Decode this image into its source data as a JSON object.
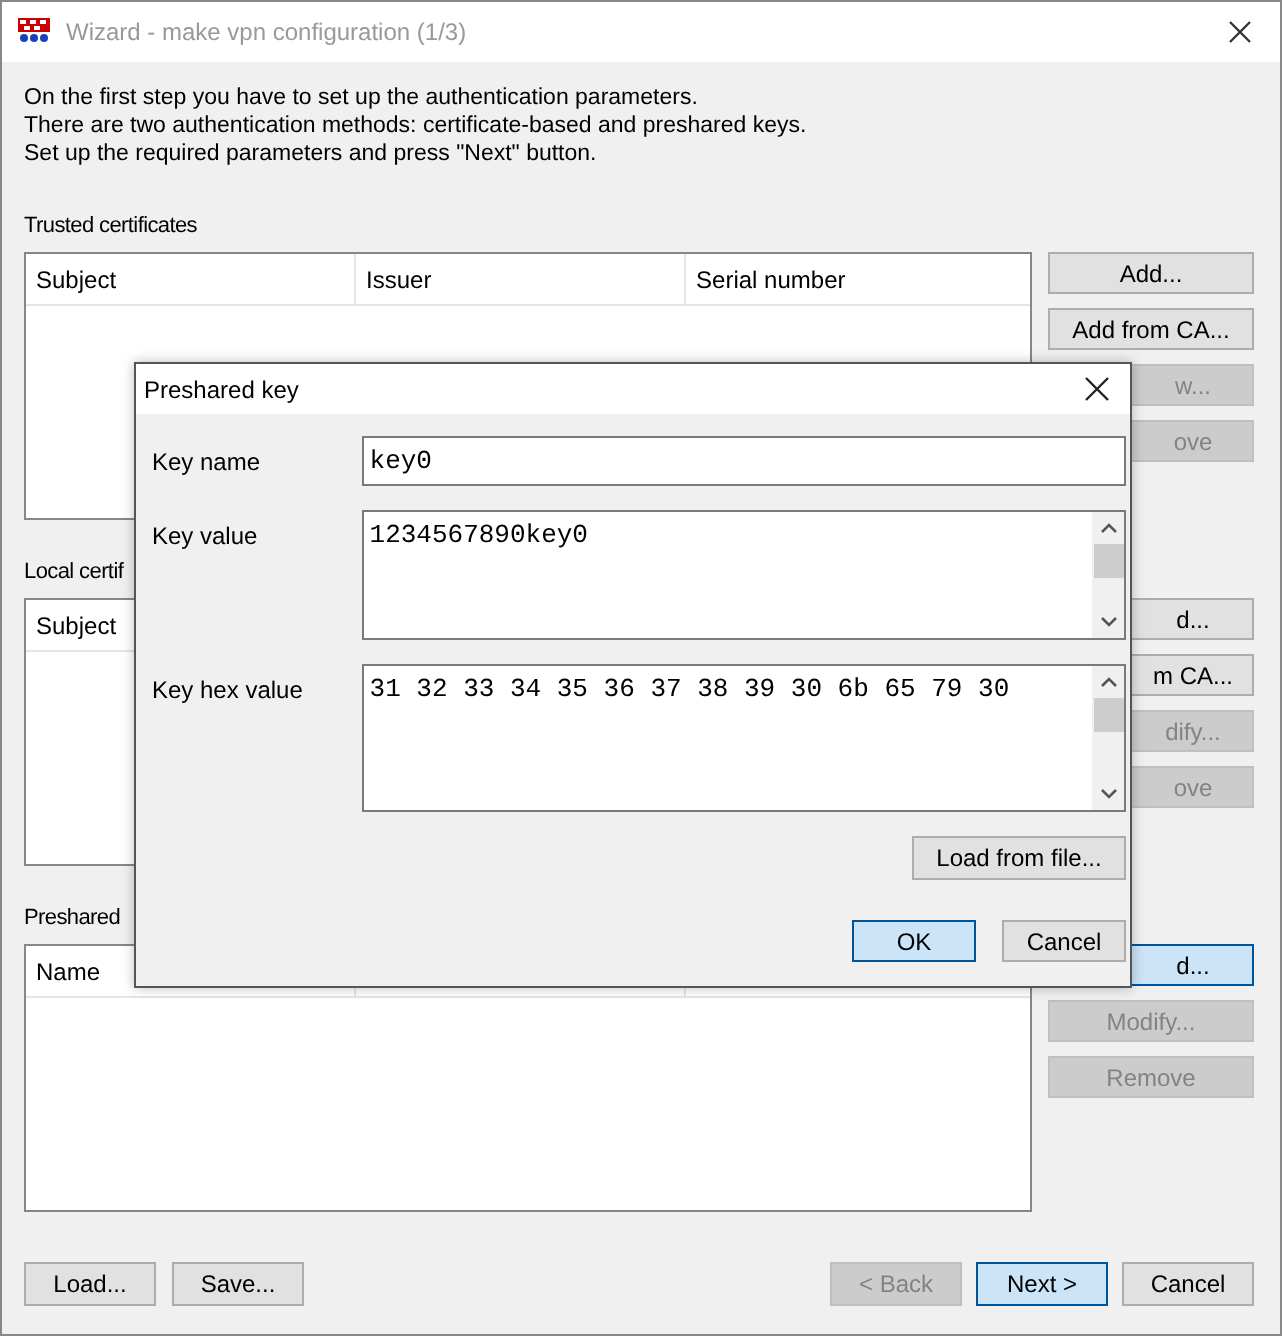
{
  "window": {
    "title": "Wizard - make vpn configuration (1/3)"
  },
  "intro": [
    "On the first step you have to set up the authentication parameters.",
    "There are two authentication methods: certificate-based and preshared keys.",
    "Set up the required parameters and press \"Next\" button."
  ],
  "sections": [
    {
      "label": "Trusted certificates",
      "columns": [
        "Subject",
        "Issuer",
        "Serial number"
      ],
      "buttons": [
        {
          "label": "Add...",
          "disabled": false,
          "covered": false,
          "highlighted": false
        },
        {
          "label": "Add from CA...",
          "disabled": false,
          "covered": false,
          "highlighted": false
        },
        {
          "label": "w...",
          "disabled": true,
          "covered": true,
          "highlighted": false
        },
        {
          "label": "ove",
          "disabled": true,
          "covered": true,
          "highlighted": false
        }
      ]
    },
    {
      "label": "Local certif",
      "columns": [
        "Subject"
      ],
      "buttons": [
        {
          "label": "d...",
          "disabled": false,
          "covered": true,
          "highlighted": false
        },
        {
          "label": "m CA...",
          "disabled": false,
          "covered": true,
          "highlighted": false
        },
        {
          "label": "dify...",
          "disabled": true,
          "covered": true,
          "highlighted": false
        },
        {
          "label": "ove",
          "disabled": true,
          "covered": true,
          "highlighted": false
        }
      ]
    },
    {
      "label": "Preshared",
      "columns": [
        "Name"
      ],
      "buttons": [
        {
          "label": "d...",
          "disabled": false,
          "covered": true,
          "highlighted": true
        },
        {
          "label": "Modify...",
          "disabled": true,
          "covered": false,
          "highlighted": false
        },
        {
          "label": "Remove",
          "disabled": true,
          "covered": false,
          "highlighted": false
        }
      ]
    }
  ],
  "footer": {
    "left": [
      {
        "label": "Load...",
        "disabled": false,
        "highlighted": false
      },
      {
        "label": "Save...",
        "disabled": false,
        "highlighted": false
      }
    ],
    "right": [
      {
        "label": "< Back",
        "disabled": true,
        "highlighted": false
      },
      {
        "label": "Next >",
        "disabled": false,
        "highlighted": true
      },
      {
        "label": "Cancel",
        "disabled": false,
        "highlighted": false
      }
    ]
  },
  "dialog": {
    "title": "Preshared key",
    "fields": [
      {
        "kind": "line",
        "label": "Key name",
        "value": "key0"
      },
      {
        "kind": "area",
        "label": "Key value",
        "value": "1234567890key0"
      },
      {
        "kind": "area",
        "label": "Key hex value",
        "value": "31 32 33 34 35 36 37 38 39 30 6b 65 79 30"
      }
    ],
    "load_button": {
      "label": "Load from file...",
      "disabled": false,
      "highlighted": false
    },
    "buttons": [
      {
        "label": "OK",
        "disabled": false,
        "highlighted": true
      },
      {
        "label": "Cancel",
        "disabled": false,
        "highlighted": false
      }
    ]
  }
}
